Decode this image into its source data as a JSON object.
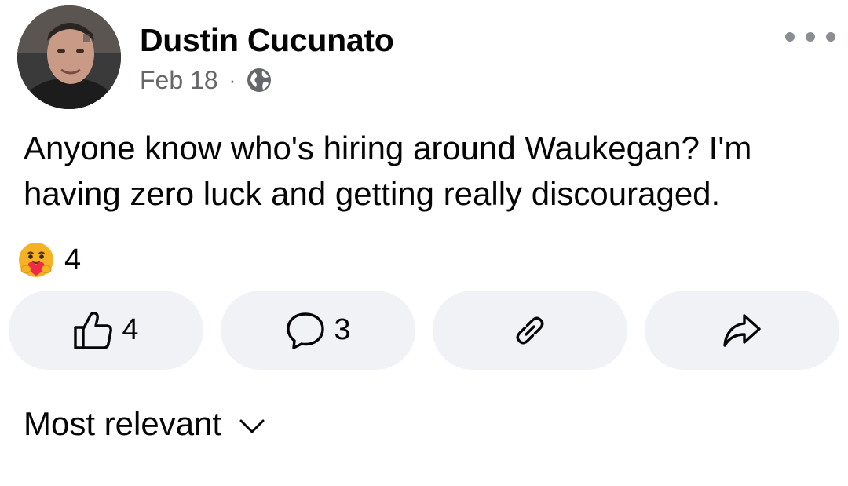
{
  "post": {
    "author": "Dustin Cucunato",
    "date": "Feb 18",
    "separator": "·",
    "privacy_icon": "globe-icon",
    "more_icon": "more-horizontal-icon",
    "text": "Anyone know who's hiring around Waukegan? I'm having zero luck and getting really discouraged."
  },
  "reactions": {
    "emoji": "care-reaction-icon",
    "count": "4"
  },
  "actions": {
    "like": {
      "icon": "thumbs-up-icon",
      "count": "4"
    },
    "comment": {
      "icon": "comment-bubble-icon",
      "count": "3"
    },
    "copy_link": {
      "icon": "link-icon"
    },
    "share": {
      "icon": "share-arrow-icon"
    }
  },
  "sort": {
    "label": "Most relevant",
    "icon": "chevron-down-icon"
  },
  "colors": {
    "button_bg": "#f0f2f5",
    "secondary_text": "#65676b",
    "primary_text": "#050505",
    "care_yellow": "#f7b125",
    "care_red": "#f0284a"
  }
}
